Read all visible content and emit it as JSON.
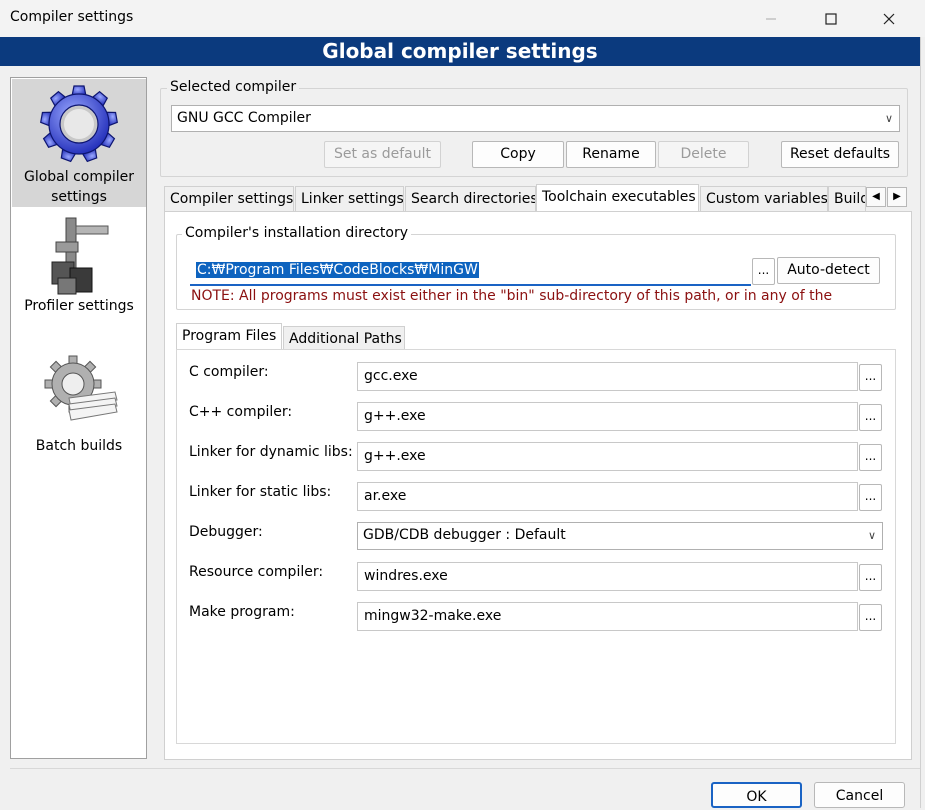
{
  "window": {
    "title": "Compiler settings",
    "minimize_icon": "minimize-icon",
    "maximize_icon": "maximize-icon",
    "close_icon": "close-icon"
  },
  "banner": {
    "title": "Global compiler settings"
  },
  "sidebar": {
    "items": [
      {
        "label": "Global compiler settings",
        "icon": "gear-icon",
        "selected": true
      },
      {
        "label": "Profiler settings",
        "icon": "caliper-icon",
        "selected": false
      },
      {
        "label": "Batch builds",
        "icon": "batch-gear-icon",
        "selected": false
      }
    ]
  },
  "selected_compiler": {
    "group_label": "Selected compiler",
    "value": "GNU GCC Compiler",
    "buttons": {
      "set_default": "Set as default",
      "copy": "Copy",
      "rename": "Rename",
      "delete": "Delete",
      "reset_defaults": "Reset defaults"
    }
  },
  "tabs": [
    {
      "label": "Compiler settings",
      "active": false
    },
    {
      "label": "Linker settings",
      "active": false
    },
    {
      "label": "Search directories",
      "active": false
    },
    {
      "label": "Toolchain executables",
      "active": true
    },
    {
      "label": "Custom variables",
      "active": false
    },
    {
      "label": "Build",
      "active": false
    }
  ],
  "toolchain": {
    "install_group_label": "Compiler's installation directory",
    "install_dir": "C:₩Program Files₩CodeBlocks₩MinGW",
    "browse": "...",
    "auto_detect": "Auto-detect",
    "note": "NOTE: All programs must exist either in the \"bin\" sub-directory of this path, or in any of the",
    "subtabs": [
      {
        "label": "Program Files",
        "active": true
      },
      {
        "label": "Additional Paths",
        "active": false
      }
    ],
    "programs": [
      {
        "label": "C compiler:",
        "value": "gcc.exe",
        "type": "text"
      },
      {
        "label": "C++ compiler:",
        "value": "g++.exe",
        "type": "text"
      },
      {
        "label": "Linker for dynamic libs:",
        "value": "g++.exe",
        "type": "text"
      },
      {
        "label": "Linker for static libs:",
        "value": "ar.exe",
        "type": "text"
      },
      {
        "label": "Debugger:",
        "value": "GDB/CDB debugger : Default",
        "type": "select"
      },
      {
        "label": "Resource compiler:",
        "value": "windres.exe",
        "type": "text"
      },
      {
        "label": "Make program:",
        "value": "mingw32-make.exe",
        "type": "text"
      }
    ]
  },
  "footer": {
    "ok": "OK",
    "cancel": "Cancel"
  }
}
